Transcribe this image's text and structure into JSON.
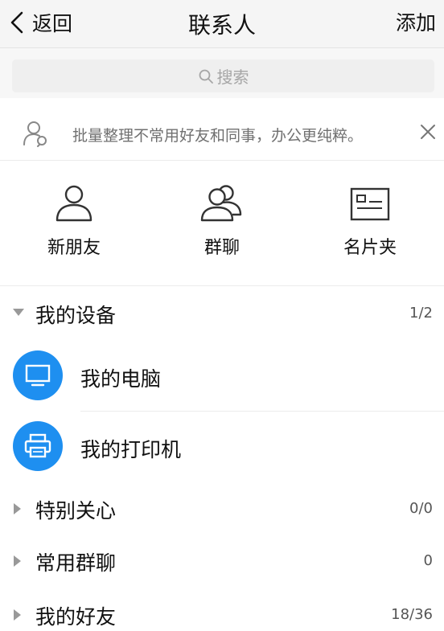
{
  "header": {
    "back_label": "返回",
    "title": "联系人",
    "add_label": "添加"
  },
  "search": {
    "placeholder": "搜索"
  },
  "tip": {
    "text": "批量整理不常用好友和同事，办公更纯粹。"
  },
  "shortcuts": [
    {
      "label": "新朋友",
      "icon": "person-icon"
    },
    {
      "label": "群聊",
      "icon": "group-icon"
    },
    {
      "label": "名片夹",
      "icon": "business-card-icon"
    }
  ],
  "groups": {
    "devices": {
      "name": "我的设备",
      "count": "1/2",
      "expanded": true
    },
    "special": {
      "name": "特别关心",
      "count": "0/0",
      "expanded": false
    },
    "common_groups": {
      "name": "常用群聊",
      "count": "0",
      "expanded": false
    },
    "friends": {
      "name": "我的好友",
      "count": "18/36",
      "expanded": false
    }
  },
  "devices": [
    {
      "name": "我的电脑",
      "icon": "computer-icon"
    },
    {
      "name": "我的打印机",
      "icon": "printer-icon"
    }
  ],
  "colors": {
    "accent": "#1e8ff0",
    "header_bg": "#f5f5f5",
    "muted_text": "#707070"
  }
}
